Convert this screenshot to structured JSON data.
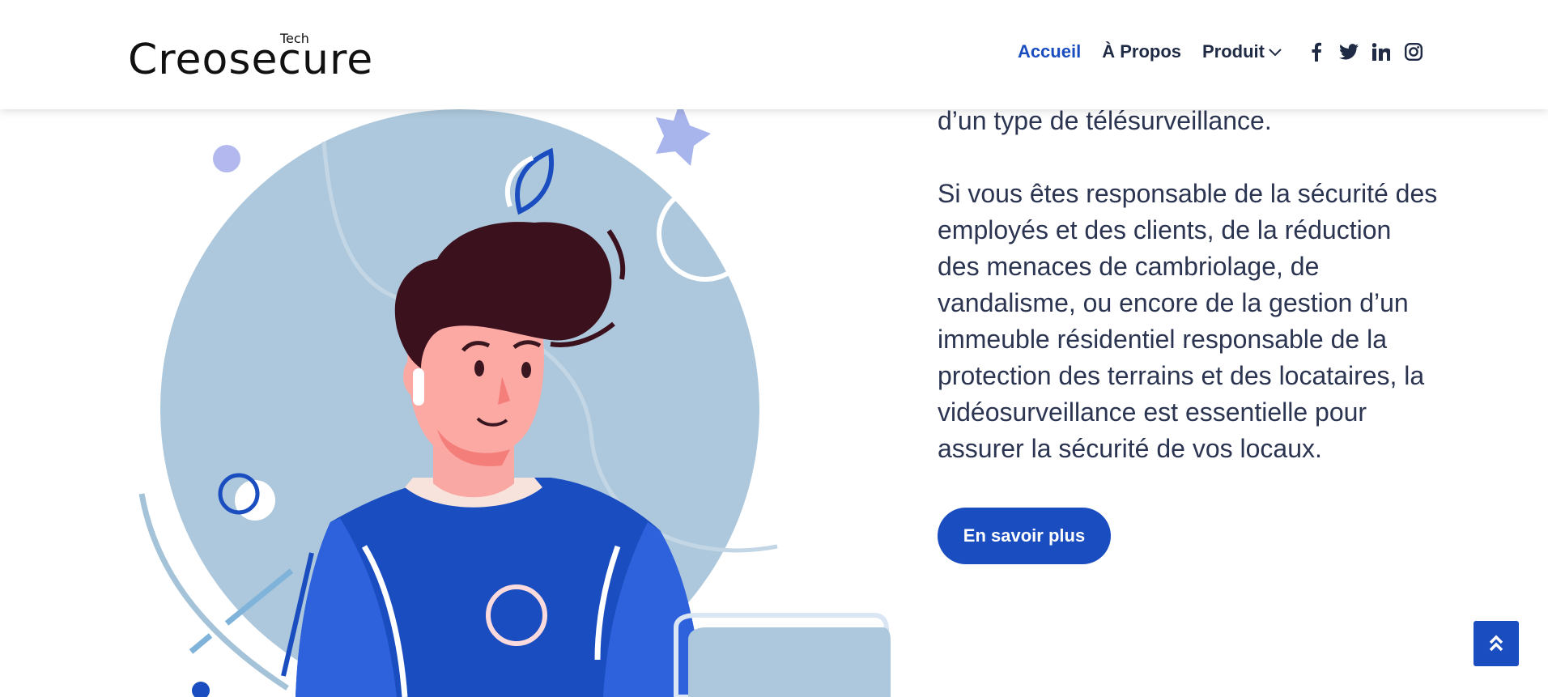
{
  "logo": {
    "name": "Creosecure",
    "tag": "Tech"
  },
  "nav": {
    "items": [
      {
        "label": "Accueil",
        "active": true
      },
      {
        "label": "À Propos",
        "active": false
      },
      {
        "label": "Produit",
        "active": false,
        "has_dropdown": true
      }
    ],
    "social_icons": [
      "facebook-icon",
      "twitter-icon",
      "linkedin-icon",
      "instagram-icon"
    ]
  },
  "content": {
    "paragraph_top": "d’un type de télésurveillance.",
    "paragraph_main": "Si vous êtes responsable de la sécurité des employés et des clients, de la réduction des menaces de cambriolage, de vandalisme, ou encore de la gestion d’un immeuble résidentiel responsable de la protection des terrains et des locataires, la vidéosurveillance est essentielle pour assurer la sécurité de vos locaux.",
    "cta_label": "En savoir plus"
  },
  "colors": {
    "accent": "#1a4dbf",
    "text": "#2b3450",
    "circle_bg": "#adc8dc"
  },
  "scroll_top_icon": "double-chevron-up-icon"
}
